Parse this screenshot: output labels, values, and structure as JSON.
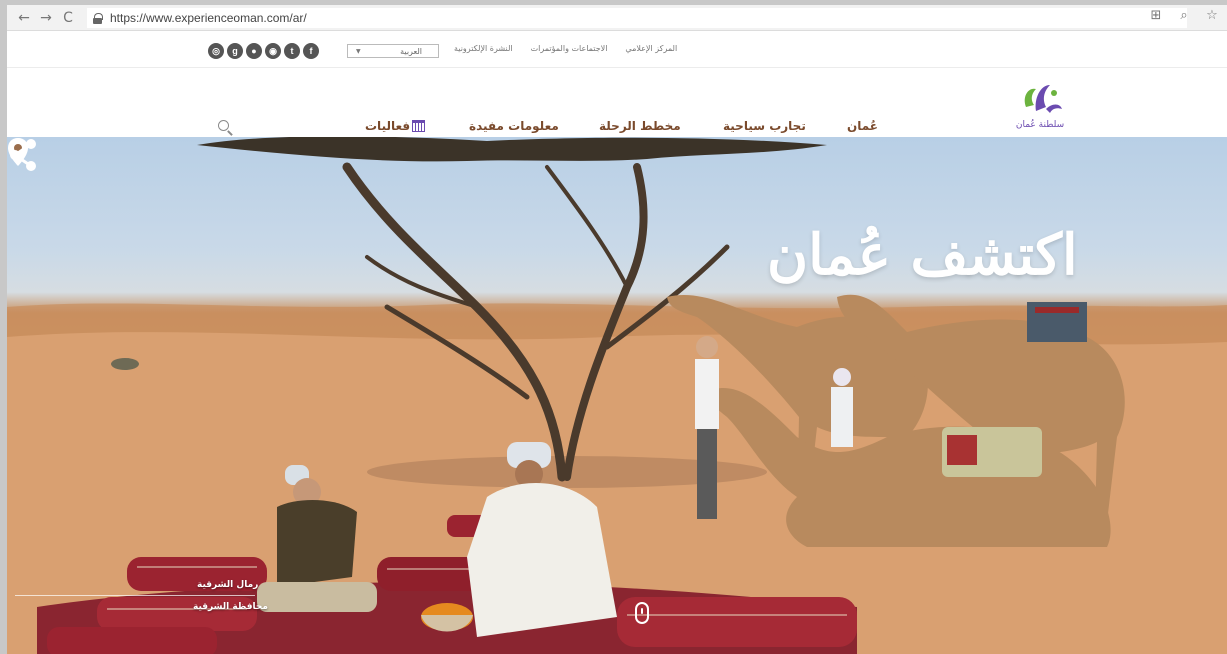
{
  "browser": {
    "url": "https://www.experienceoman.com/ar/"
  },
  "utility_bar": {
    "social_icons": [
      "instagram-icon",
      "google-plus-icon",
      "tripadvisor-icon",
      "foursquare-icon",
      "twitter-icon",
      "facebook-icon"
    ],
    "language_select_value": "العربية",
    "links": [
      "النشرة الإلكترونية",
      "الاجتماعات والمؤتمرات",
      "المركز الإعلامي"
    ]
  },
  "header": {
    "logo_text": "سلطنة عُمان",
    "nav": {
      "oman": "عُمان",
      "experiences": "تجارب سياحية",
      "trip_planner": "مخطط الرحلة",
      "useful_info": "معلومات مفيدة",
      "events": "فعاليات"
    }
  },
  "hero": {
    "title": "اكتشف عُمان",
    "location_line1": "رمال الشرقية",
    "location_line2": "محافظة الشرقية"
  },
  "colors": {
    "nav_text": "#7a4a2c",
    "logo_purple": "#6b4bb0",
    "logo_green": "#6cb33f"
  }
}
